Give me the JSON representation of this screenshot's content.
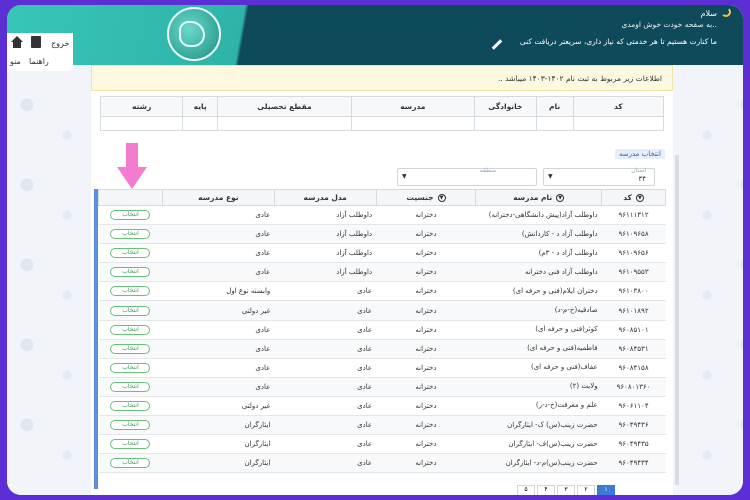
{
  "header": {
    "greeting": "سلام",
    "welcome": "به صفحه خودت خوش اومدی..",
    "tagline": "ما کنارت هستیم تا هر خدمتی که نیاز داری، سریعتر دریافت کنی"
  },
  "nav": {
    "logout": "خروج",
    "guide": "راهنما",
    "menu": "منو"
  },
  "alert": "اطلاعات زیر مربوط به ثبت نام ۱۴۰۲-۱۴۰۳ میباشد ..",
  "summary_table": {
    "headers": [
      "کد",
      "نام",
      "خانوادگی",
      "مدرسه",
      "مقطع تحصیلی",
      "پایه",
      "رشته"
    ]
  },
  "select_school_label": "انتخاب مدرسه",
  "filters": {
    "province_label": "استان",
    "province_value": "۳۴",
    "region_label": "منطقه",
    "region_value": ""
  },
  "schools_table": {
    "headers": {
      "code": "کد",
      "name": "نام مدرسه",
      "gender": "جنسیت",
      "model": "مدل مدرسه",
      "type": "نوع مدرسه",
      "action": ""
    },
    "select_label": "انتخاب",
    "rows": [
      {
        "code": "۹۶۱۱۱۳۱۲",
        "name": "داوطلب آزاد(پیش دانشگاهی-دخترانه)",
        "gender": "دخترانه",
        "model": "داوطلب آزاد",
        "type": "عادی"
      },
      {
        "code": "۹۶۱۰۹۶۵۸",
        "name": "داوطلب آزاد د - کاردانش)",
        "gender": "دخترانه",
        "model": "داوطلب آزاد",
        "type": "عادی"
      },
      {
        "code": "۹۶۱۰۹۶۵۶",
        "name": "داوطلب آزاد د - ۳م)",
        "gender": "دخترانه",
        "model": "داوطلب آزاد",
        "type": "عادی"
      },
      {
        "code": "۹۶۱۰۹۵۵۳",
        "name": "داوطلب آزاد فنی دخترانه",
        "gender": "دخترانه",
        "model": "داوطلب آزاد",
        "type": "عادی"
      },
      {
        "code": "۹۶۱۰۳۸۰۰",
        "name": "دختران ایلام(فنی و حرفه ای)",
        "gender": "دخترانه",
        "model": "عادی",
        "type": "وابسته نوع اول"
      },
      {
        "code": "۹۶۱۰۱۸۹۲",
        "name": "صادقیه(خ-م-د)",
        "gender": "دخترانه",
        "model": "عادی",
        "type": "غیر دولتی"
      },
      {
        "code": "۹۶۰۸۵۱۰۱",
        "name": "کوثر(فنی و حرفه ای)",
        "gender": "دخترانه",
        "model": "عادی",
        "type": "عادی"
      },
      {
        "code": "۹۶۰۸۴۵۳۱",
        "name": "فاطمیه(فنی و حرفه ای)",
        "gender": "دخترانه",
        "model": "عادی",
        "type": "عادی"
      },
      {
        "code": "۹۶۰۸۴۱۵۸",
        "name": "عفاف(فنی و حرفه ای)",
        "gender": "دخترانه",
        "model": "عادی",
        "type": "عادی"
      },
      {
        "code": "۹۶۰۸۰۱۳۶۰",
        "name": "ولایت (۲)",
        "gender": "دخترانه",
        "model": "عادی",
        "type": "عادی"
      },
      {
        "code": "۹۶۰۶۱۱۰۴",
        "name": "علم و معرفت(خ-د-ر)",
        "gender": "دخترانه",
        "model": "عادی",
        "type": "غیر دولتی"
      },
      {
        "code": "۹۶۰۴۹۴۳۶",
        "name": "حضرت زینب(س) ک- ایثارگران",
        "gender": "دخترانه",
        "model": "عادی",
        "type": "ایثارگران"
      },
      {
        "code": "۹۶۰۴۹۴۳۵",
        "name": "حضرت زینب(س)ف- ایثارگران",
        "gender": "دخترانه",
        "model": "عادی",
        "type": "ایثارگران"
      },
      {
        "code": "۹۶۰۴۹۴۳۴",
        "name": "حضرت زینب(س)م-د- ایثارگران",
        "gender": "دخترانه",
        "model": "عادی",
        "type": "ایثارگران"
      }
    ]
  },
  "pager": {
    "pages": [
      "۱",
      "۲",
      "۳",
      "۴",
      "۵"
    ],
    "active": "۱"
  },
  "colors": {
    "outer_border": "#5b2fd3",
    "header_dark": "#0e4a5a",
    "header_teal": "#37c6b8",
    "select_button": "#3b9b4d",
    "annotation_arrow": "#f37bd2"
  }
}
